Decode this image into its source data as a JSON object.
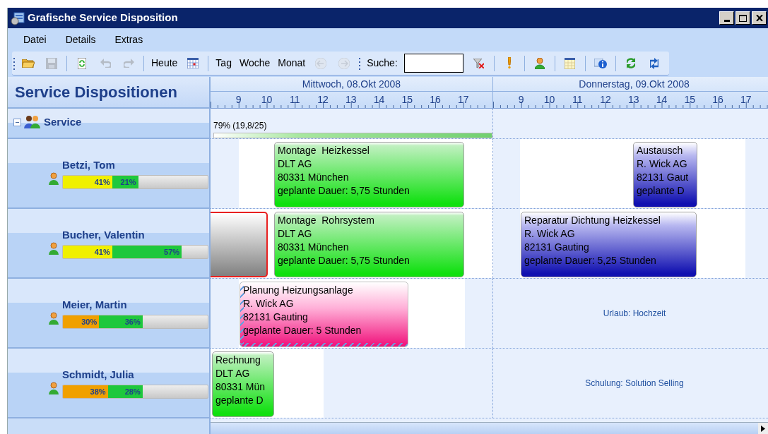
{
  "window": {
    "title": "Grafische Service Disposition"
  },
  "menu": [
    {
      "label": "Datei"
    },
    {
      "label": "Details"
    },
    {
      "label": "Extras"
    }
  ],
  "toolbar": [
    {
      "kind": "icon",
      "disabled": false
    },
    {
      "kind": "icon",
      "disabled": true
    },
    {
      "kind": "icon",
      "disabled": false
    },
    {
      "kind": "icon",
      "disabled": true
    },
    {
      "kind": "icon",
      "disabled": true
    },
    {
      "kind": "text",
      "label": "Heute"
    },
    {
      "kind": "icon",
      "disabled": false
    },
    {
      "kind": "text",
      "label": "Tag"
    },
    {
      "kind": "text",
      "label": "Woche"
    },
    {
      "kind": "text",
      "label": "Monat"
    },
    {
      "kind": "icon",
      "disabled": true
    },
    {
      "kind": "icon",
      "disabled": true
    },
    {
      "kind": "search",
      "label": "Suche:"
    },
    {
      "kind": "icon",
      "disabled": false
    },
    {
      "kind": "icon",
      "disabled": false
    },
    {
      "kind": "icon",
      "disabled": false
    },
    {
      "kind": "icon",
      "disabled": false
    },
    {
      "kind": "icon",
      "disabled": false
    },
    {
      "kind": "icon",
      "disabled": false
    },
    {
      "kind": "icon",
      "disabled": false
    }
  ],
  "panel": {
    "title": "Service Dispositionen",
    "group": {
      "label": "Service",
      "expanded": true,
      "load": "79% (19,8/25)",
      "children": [
        {
          "name": "Betzi, Tom",
          "segments": [
            {
              "label": "41%",
              "level": 0.34,
              "color": "#f0f000"
            },
            {
              "label": "21%",
              "color": "#1ec83c"
            }
          ]
        },
        {
          "name": "Bucher, Valentin",
          "segments": [
            {
              "label": "41%",
              "level": 0.34,
              "color": "#f0f000"
            },
            {
              "label": "57%",
              "color": "#1ec83c"
            }
          ]
        },
        {
          "name": "Meier, Martin",
          "segments": [
            {
              "label": "30%",
              "level": 0.25,
              "color": "#f0a000"
            },
            {
              "label": "36%",
              "color": "#1ec83c"
            }
          ]
        },
        {
          "name": "Schmidt, Julia",
          "segments": [
            {
              "label": "38%",
              "level": 0.31,
              "color": "#f0a000"
            },
            {
              "label": "28%",
              "color": "#1ec83c"
            }
          ]
        }
      ]
    }
  },
  "days": [
    {
      "label": "Mittwoch, 08.Okt 2008",
      "hours": [
        "9",
        "10",
        "11",
        "12",
        "13",
        "14",
        "15",
        "16",
        "17"
      ]
    },
    {
      "label": "Donnerstag, 09.Okt 2008",
      "hours": [
        "9",
        "10",
        "11",
        "12",
        "13",
        "14",
        "15",
        "16",
        "17"
      ]
    }
  ],
  "rows": [
    {
      "appointments": [
        {
          "kind": "normal",
          "color": "#10e010",
          "lines": [
            "Montage  Heizkessel",
            "DLT AG",
            "80331 München",
            "geplante Dauer: 5,75 Stunden"
          ]
        },
        {
          "kind": "normal",
          "color": "#1010b0",
          "lines": [
            "Austausch",
            "R. Wick AG",
            "82131 Gaut",
            "geplante D"
          ]
        }
      ]
    },
    {
      "appointments": [
        {
          "kind": "blocked",
          "color": "#808080"
        },
        {
          "kind": "normal",
          "color": "#10e010",
          "lines": [
            "Montage  Rohrsystem",
            "DLT AG",
            "80331 München",
            "geplante Dauer: 5,75 Stunden"
          ]
        },
        {
          "kind": "normal",
          "color": "#1010b0",
          "lines": [
            "Reparatur Dichtung Heizkessel",
            "R. Wick AG",
            "82131 Gauting",
            "geplante Dauer: 5,25 Stunden"
          ]
        }
      ]
    },
    {
      "appointments": [
        {
          "kind": "tentative",
          "color": "#f0107a",
          "lines": [
            "Planung Heizungsanlage",
            "R. Wick AG",
            "82131 Gauting",
            "geplante Dauer: 5 Stunden"
          ]
        }
      ],
      "note": "Urlaub: Hochzeit"
    },
    {
      "appointments": [
        {
          "kind": "normal",
          "color": "#10e010",
          "lines": [
            "Rechnung",
            "DLT AG",
            "80331 Mün",
            "geplante D"
          ]
        }
      ],
      "note": "Schulung: Solution Selling"
    }
  ]
}
